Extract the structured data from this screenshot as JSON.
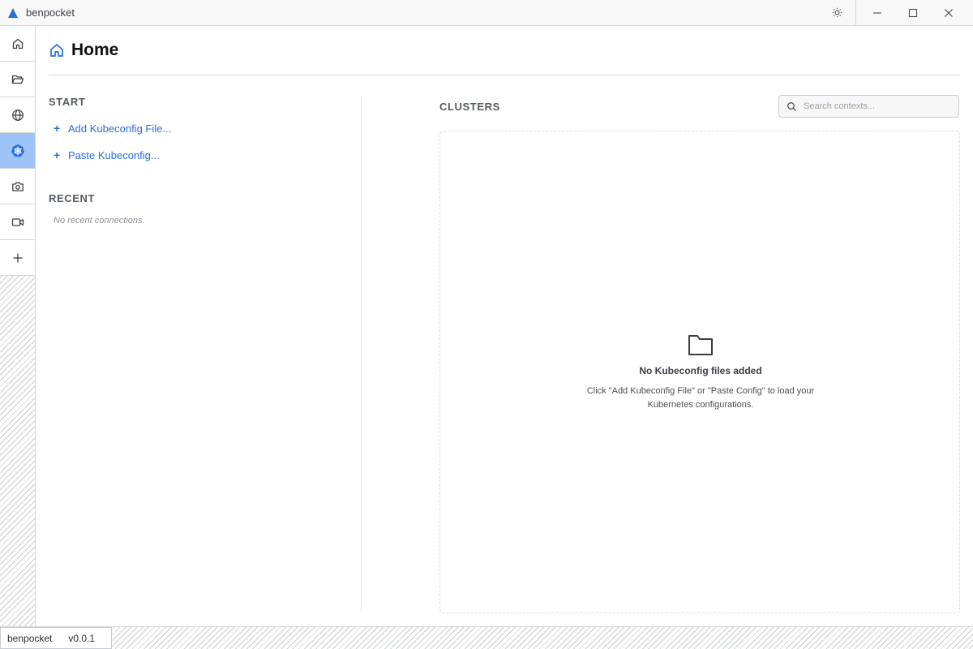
{
  "window": {
    "app_title": "benpocket",
    "logo_icon": "triangle-logo-icon",
    "accent_color": "#2a6fdb",
    "controls": [
      "theme-toggle-icon",
      "minimize-icon",
      "maximize-icon",
      "close-icon"
    ]
  },
  "sidebar": {
    "items": [
      {
        "id": "home",
        "icon": "home-icon",
        "active": false
      },
      {
        "id": "files",
        "icon": "folder-open-icon",
        "active": false
      },
      {
        "id": "network",
        "icon": "globe-icon",
        "active": false
      },
      {
        "id": "kubernetes",
        "icon": "kubernetes-icon",
        "active": true
      },
      {
        "id": "camera",
        "icon": "camera-icon",
        "active": false
      },
      {
        "id": "video",
        "icon": "video-icon",
        "active": false
      },
      {
        "id": "add",
        "icon": "plus-icon",
        "active": false
      }
    ]
  },
  "header": {
    "title": "Home",
    "icon": "home-icon"
  },
  "start": {
    "label": "START",
    "actions": [
      {
        "plus": "+",
        "label": "Add Kubeconfig File..."
      },
      {
        "plus": "+",
        "label": "Paste Kubeconfig..."
      }
    ]
  },
  "recent": {
    "label": "RECENT",
    "empty": "No recent connections."
  },
  "clusters": {
    "label": "CLUSTERS",
    "search_placeholder": "Search contexts...",
    "search_value": "",
    "empty_title": "No Kubeconfig files added",
    "empty_desc": "Click \"Add Kubeconfig File\" or \"Paste Config\" to load your Kubernetes configurations."
  },
  "status": {
    "app_name": "benpocket",
    "version": "v0.0.1"
  }
}
